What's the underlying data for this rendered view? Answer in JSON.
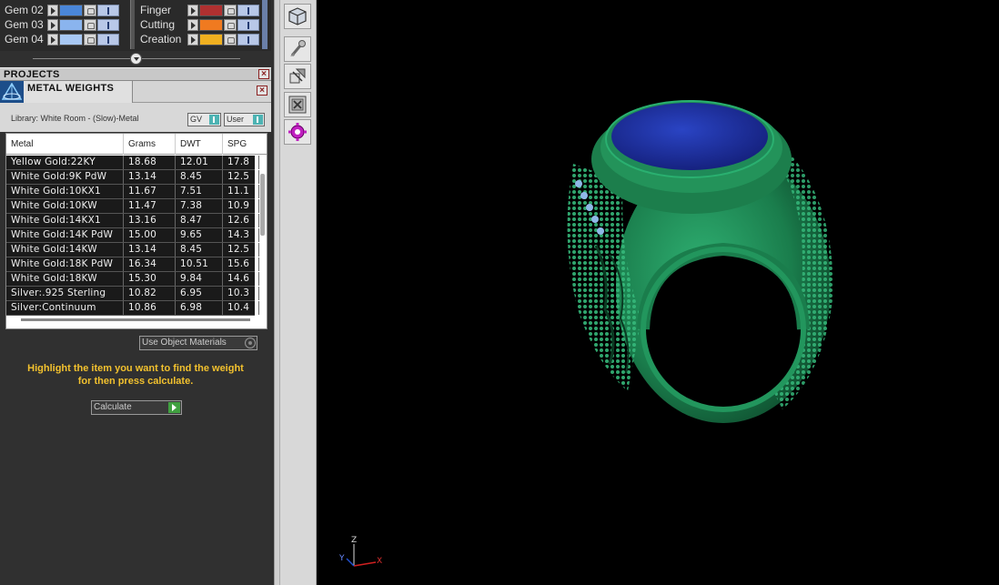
{
  "layers": {
    "left": [
      {
        "name": "Gem 02",
        "color": "#4a86d8"
      },
      {
        "name": "Gem 03",
        "color": "#8ab4ee"
      },
      {
        "name": "Gem 04",
        "color": "#a8c8f4"
      }
    ],
    "right": [
      {
        "name": "Finger",
        "color": "#b03030"
      },
      {
        "name": "Cutting",
        "color": "#f07a20"
      },
      {
        "name": "Creation",
        "color": "#f0b020"
      }
    ]
  },
  "projects": {
    "title": "PROJECTS"
  },
  "metal_weights": {
    "title": "METAL WEIGHTS",
    "library": "Library: White Room - (Slow)-Metal",
    "gv_label": "GV",
    "user_label": "User",
    "columns": [
      "Metal",
      "Grams",
      "DWT",
      "SPG"
    ],
    "rows": [
      [
        "Yellow Gold:22KY",
        "18.68",
        "12.01",
        "17.8"
      ],
      [
        "White Gold:9K PdW",
        "13.14",
        "8.45",
        "12.5"
      ],
      [
        "White Gold:10KX1",
        "11.67",
        "7.51",
        "11.1"
      ],
      [
        "White Gold:10KW",
        "11.47",
        "7.38",
        "10.9"
      ],
      [
        "White Gold:14KX1",
        "13.16",
        "8.47",
        "12.6"
      ],
      [
        "White Gold:14K PdW",
        "15.00",
        "9.65",
        "14.3"
      ],
      [
        "White Gold:14KW",
        "13.14",
        "8.45",
        "12.5"
      ],
      [
        "White Gold:18K PdW",
        "16.34",
        "10.51",
        "15.6"
      ],
      [
        "White Gold:18KW",
        "15.30",
        "9.84",
        "14.6"
      ],
      [
        "Silver:.925 Sterling",
        "10.82",
        "6.95",
        "10.3"
      ],
      [
        "Silver:Continuum",
        "10.86",
        "6.98",
        "10.4"
      ]
    ],
    "use_object_materials": "Use Object Materials",
    "hint_line1": "Highlight the item you want to find the weight",
    "hint_line2": "for then press calculate.",
    "calculate_label": "Calculate"
  },
  "toolbar": {
    "tools": [
      "view-cube-icon",
      "paint-brush-icon",
      "transform-icon",
      "close-box-icon",
      "settings-gear-icon"
    ]
  },
  "viewport": {
    "axes": {
      "z": "Z",
      "y": "Y",
      "x": "X"
    },
    "colors": {
      "metal": "#1e8a55",
      "stone": "#1a2fa0"
    }
  }
}
